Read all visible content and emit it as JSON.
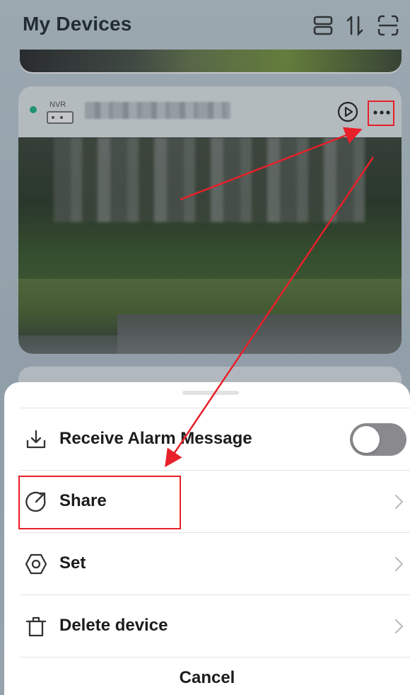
{
  "header": {
    "title": "My Devices",
    "icons": [
      "list-view-icon",
      "sort-icon",
      "scan-icon"
    ]
  },
  "device_card": {
    "type_label": "NVR",
    "status_color": "#1fb88a",
    "icons": [
      "play-icon",
      "more-icon"
    ]
  },
  "sheet": {
    "items": [
      {
        "label": "Receive Alarm Message",
        "icon": "download-icon",
        "control": "toggle",
        "toggle_on": false
      },
      {
        "label": "Share",
        "icon": "share-icon",
        "control": "chevron"
      },
      {
        "label": "Set",
        "icon": "settings-hexagon-icon",
        "control": "chevron"
      },
      {
        "label": "Delete device",
        "icon": "trash-icon",
        "control": "chevron"
      }
    ],
    "cancel_label": "Cancel"
  },
  "annotation": {
    "color": "#e8202a"
  }
}
